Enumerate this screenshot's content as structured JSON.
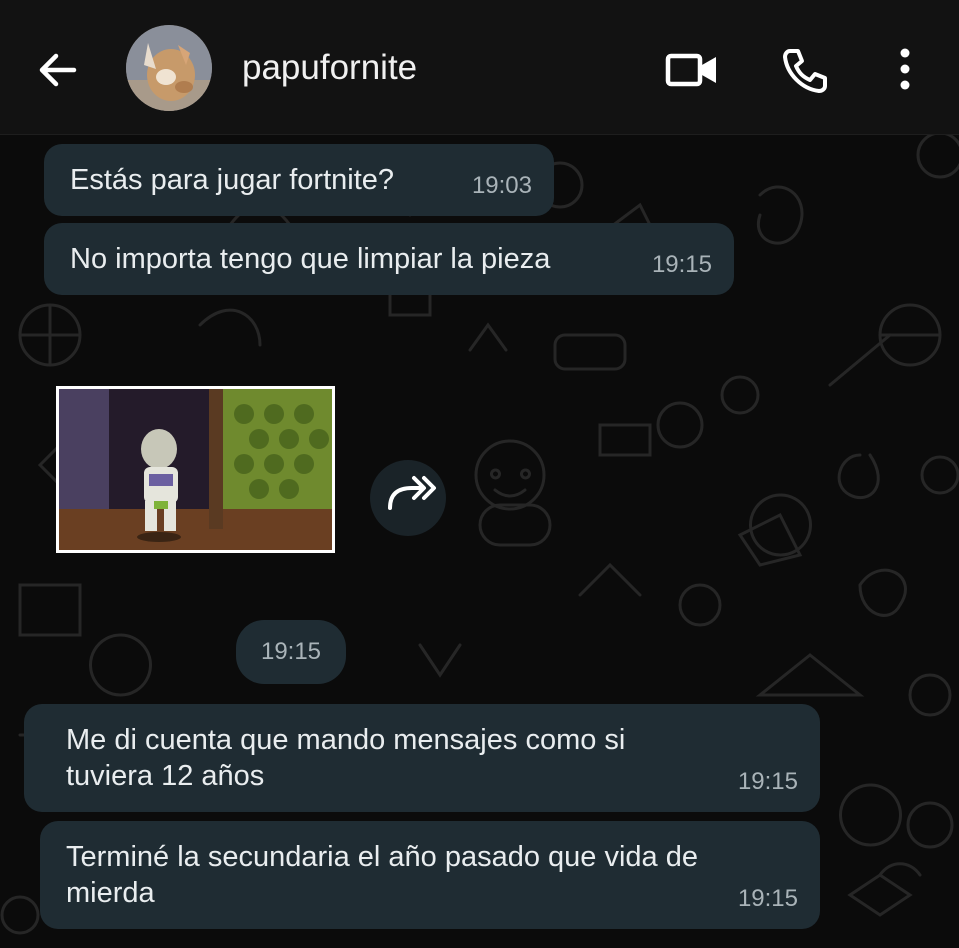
{
  "header": {
    "contact_name": "papufornite",
    "icons": {
      "back": "back-arrow-icon",
      "video": "video-camera-icon",
      "call": "phone-icon",
      "menu": "more-vertical-icon"
    }
  },
  "messages": [
    {
      "text": "Estás para jugar fortnite?",
      "time": "19:03"
    },
    {
      "text": "No importa tengo que limpiar la pieza",
      "time": "19:15"
    },
    {
      "type": "media",
      "time": "19:15"
    },
    {
      "text": "Me di cuenta que mando mensajes como si\ntuviera 12 años",
      "time": "19:15"
    },
    {
      "text": "Terminé la secundaria el año pasado que vida de\nmierda",
      "time": "19:15"
    }
  ],
  "colors": {
    "background": "#0b0b0b",
    "header": "#121212",
    "bubble": "#1f2c33",
    "text": "#e9edef",
    "timestamp": "#a9b3b8"
  }
}
